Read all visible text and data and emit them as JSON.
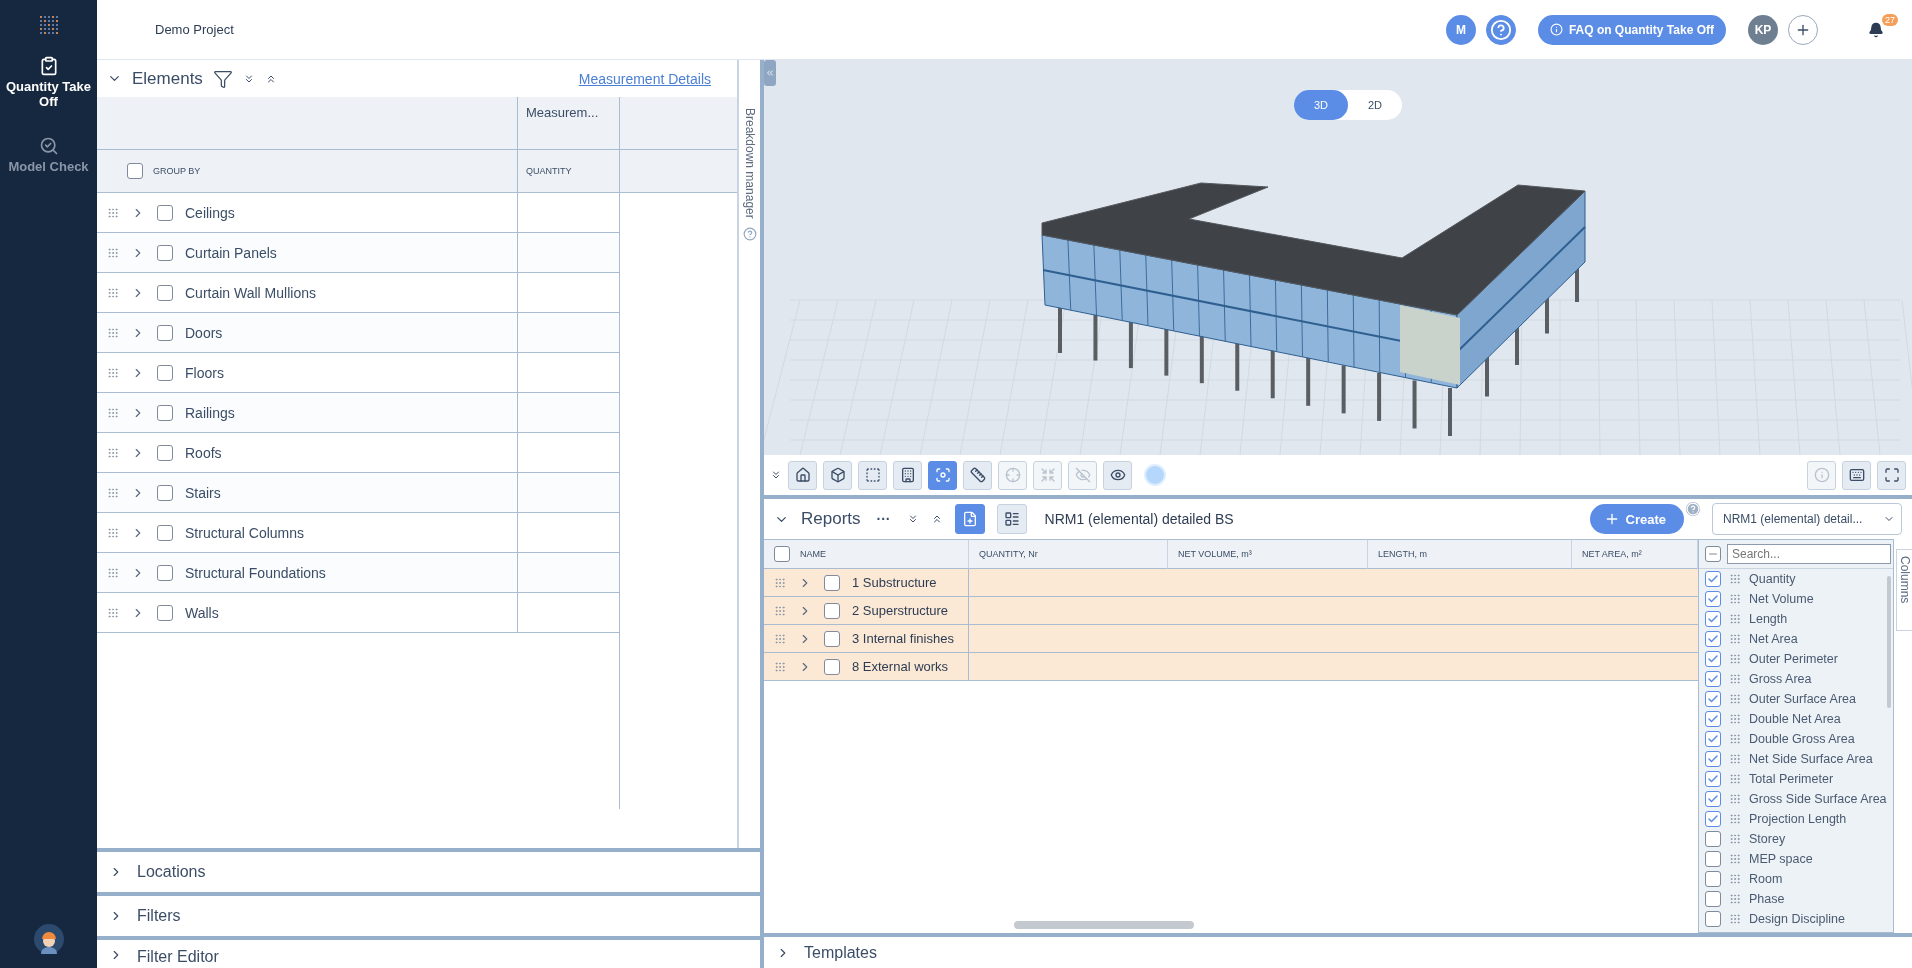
{
  "topbar": {
    "project": "Demo Project",
    "user_initial": "M",
    "faq": "FAQ on Quantity Take Off",
    "account_initials": "KP",
    "notifications": "27"
  },
  "sidebar": {
    "items": [
      {
        "label": "Quantity Take Off",
        "selected": true
      },
      {
        "label": "Model Check",
        "selected": false
      }
    ]
  },
  "elements": {
    "title": "Elements",
    "link": "Measurement Details",
    "measure_header": "Measurem...",
    "group_by": "GROUP BY",
    "group_checked": false,
    "quantity_header": "QUANTITY",
    "rows": [
      {
        "label": "Ceilings",
        "checked": false
      },
      {
        "label": "Curtain Panels",
        "checked": false
      },
      {
        "label": "Curtain Wall Mullions",
        "checked": false
      },
      {
        "label": "Doors",
        "checked": false
      },
      {
        "label": "Floors",
        "checked": false
      },
      {
        "label": "Railings",
        "checked": false
      },
      {
        "label": "Roofs",
        "checked": false
      },
      {
        "label": "Stairs",
        "checked": false
      },
      {
        "label": "Structural Columns",
        "checked": false
      },
      {
        "label": "Structural Foundations",
        "checked": false
      },
      {
        "label": "Walls",
        "checked": false
      }
    ]
  },
  "breakdown_tab": "Breakdown manager",
  "left_sections": [
    {
      "label": "Locations",
      "expanded": false
    },
    {
      "label": "Filters",
      "expanded": false
    },
    {
      "label": "Filter Editor",
      "expanded": false
    }
  ],
  "viewer": {
    "views": [
      {
        "label": "3D",
        "selected": true
      },
      {
        "label": "2D",
        "selected": false
      }
    ],
    "tools": [
      {
        "selected": false,
        "disabled": false
      },
      {
        "selected": false,
        "disabled": false
      },
      {
        "selected": false,
        "disabled": false
      },
      {
        "selected": false,
        "disabled": false
      },
      {
        "selected": true,
        "disabled": false
      },
      {
        "selected": false,
        "disabled": false
      },
      {
        "selected": false,
        "disabled": true
      },
      {
        "selected": false,
        "disabled": true
      },
      {
        "selected": false,
        "disabled": true
      },
      {
        "selected": false,
        "disabled": false
      }
    ],
    "side_tools": [
      {
        "selected": false,
        "disabled": true
      },
      {
        "selected": false,
        "disabled": false
      },
      {
        "selected": false,
        "disabled": false
      }
    ]
  },
  "reports": {
    "title": "Reports",
    "menu": "···",
    "views": [
      {
        "selected": true
      },
      {
        "selected": false
      }
    ],
    "template": "NRM1 (elemental) detailed BS",
    "create": "Create",
    "select_value": "NRM1 (elemental) detail...",
    "all_checked": false,
    "columns": [
      "NAME",
      "QUANTITY, Nr",
      "NET VOLUME, m³",
      "LENGTH, m",
      "NET AREA, m²"
    ],
    "rows": [
      {
        "label": "1 Substructure",
        "checked": false
      },
      {
        "label": "2 Superstructure",
        "checked": false
      },
      {
        "label": "3 Internal finishes",
        "checked": false
      },
      {
        "label": "8 External works",
        "checked": false
      }
    ],
    "columns_panel": {
      "placeholder": "Search...",
      "select_all_indeterminate": true,
      "items": [
        {
          "label": "Quantity",
          "checked": true
        },
        {
          "label": "Net Volume",
          "checked": true
        },
        {
          "label": "Length",
          "checked": true
        },
        {
          "label": "Net Area",
          "checked": true
        },
        {
          "label": "Outer Perimeter",
          "checked": true
        },
        {
          "label": "Gross Area",
          "checked": true
        },
        {
          "label": "Outer Surface Area",
          "checked": true
        },
        {
          "label": "Double Net Area",
          "checked": true
        },
        {
          "label": "Double Gross Area",
          "checked": true
        },
        {
          "label": "Net Side Surface Area",
          "checked": true
        },
        {
          "label": "Total Perimeter",
          "checked": true
        },
        {
          "label": "Gross Side Surface Area",
          "checked": true
        },
        {
          "label": "Projection Length",
          "checked": true
        },
        {
          "label": "Storey",
          "checked": false
        },
        {
          "label": "MEP space",
          "checked": false
        },
        {
          "label": "Room",
          "checked": false
        },
        {
          "label": "Phase",
          "checked": false
        },
        {
          "label": "Design Discipline",
          "checked": false
        }
      ]
    },
    "columns_tab": "Columns"
  },
  "templates": {
    "label": "Templates",
    "expanded": false
  }
}
